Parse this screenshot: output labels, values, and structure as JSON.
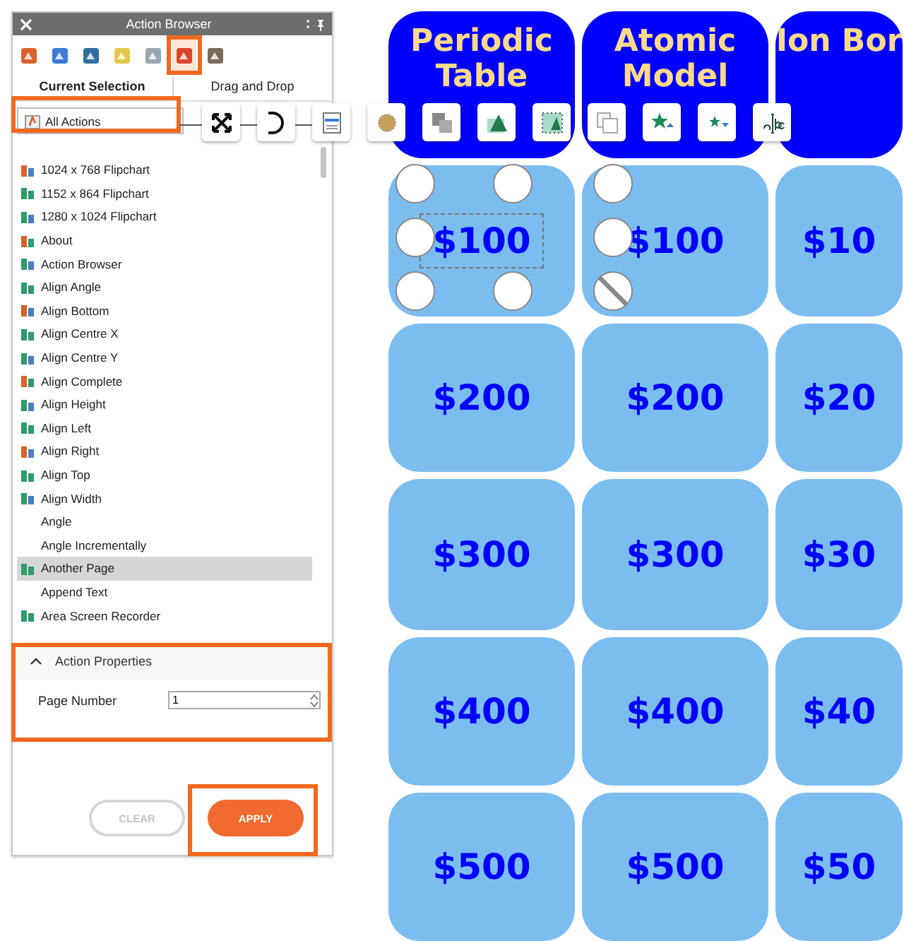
{
  "panel": {
    "title": "Action Browser",
    "icon_tabs": [
      {
        "selected": false
      },
      {
        "selected": false
      },
      {
        "selected": false
      },
      {
        "selected": false
      },
      {
        "selected": false
      },
      {
        "selected": true
      },
      {
        "selected": false
      }
    ],
    "tabs": [
      {
        "label": "Current Selection",
        "selected": true
      },
      {
        "label": "Drag and Drop",
        "selected": false
      }
    ],
    "filter": {
      "value": "All Actions"
    },
    "actions": [
      {
        "label": "1024 x 768 Flipchart",
        "has_icon": true,
        "selected": false
      },
      {
        "label": "1152 x 864 Flipchart",
        "has_icon": true,
        "selected": false
      },
      {
        "label": "1280 x 1024 Flipchart",
        "has_icon": true,
        "selected": false
      },
      {
        "label": "About",
        "has_icon": true,
        "selected": false
      },
      {
        "label": "Action Browser",
        "has_icon": true,
        "selected": false
      },
      {
        "label": "Align Angle",
        "has_icon": true,
        "selected": false
      },
      {
        "label": "Align Bottom",
        "has_icon": true,
        "selected": false
      },
      {
        "label": "Align Centre X",
        "has_icon": true,
        "selected": false
      },
      {
        "label": "Align Centre Y",
        "has_icon": true,
        "selected": false
      },
      {
        "label": "Align Complete",
        "has_icon": true,
        "selected": false
      },
      {
        "label": "Align Height",
        "has_icon": true,
        "selected": false
      },
      {
        "label": "Align Left",
        "has_icon": true,
        "selected": false
      },
      {
        "label": "Align Right",
        "has_icon": true,
        "selected": false
      },
      {
        "label": "Align Top",
        "has_icon": true,
        "selected": false
      },
      {
        "label": "Align Width",
        "has_icon": true,
        "selected": false
      },
      {
        "label": "Angle",
        "has_icon": false,
        "selected": false
      },
      {
        "label": "Angle Incrementally",
        "has_icon": false,
        "selected": false
      },
      {
        "label": "Another Page",
        "has_icon": true,
        "selected": true
      },
      {
        "label": "Append Text",
        "has_icon": false,
        "selected": false
      },
      {
        "label": "Area Screen Recorder",
        "has_icon": true,
        "selected": false
      }
    ],
    "properties": {
      "title": "Action Properties",
      "expanded": true,
      "fields": [
        {
          "label": "Page Number",
          "value": "1"
        }
      ]
    },
    "buttons": [
      {
        "label": "CLEAR",
        "disabled": true
      },
      {
        "label": "APPLY",
        "disabled": false
      }
    ]
  },
  "board": {
    "columns": [
      {
        "title": "Periodic Table",
        "cells": [
          {
            "value": "$100",
            "selected": true
          },
          {
            "value": "$200",
            "selected": false
          },
          {
            "value": "$300",
            "selected": false
          },
          {
            "value": "$400",
            "selected": false
          },
          {
            "value": "$500",
            "selected": false
          }
        ]
      },
      {
        "title": "Atomic Model",
        "cells": [
          {
            "value": "$100",
            "selected": false
          },
          {
            "value": "$200",
            "selected": false
          },
          {
            "value": "$300",
            "selected": false
          },
          {
            "value": "$400",
            "selected": false
          },
          {
            "value": "$500",
            "selected": false
          }
        ]
      },
      {
        "title": "Ion Bor",
        "cells": [
          {
            "value": "$10",
            "selected": false
          },
          {
            "value": "$20",
            "selected": false
          },
          {
            "value": "$30",
            "selected": false
          },
          {
            "value": "$40",
            "selected": false
          },
          {
            "value": "$50",
            "selected": false
          }
        ]
      }
    ]
  }
}
